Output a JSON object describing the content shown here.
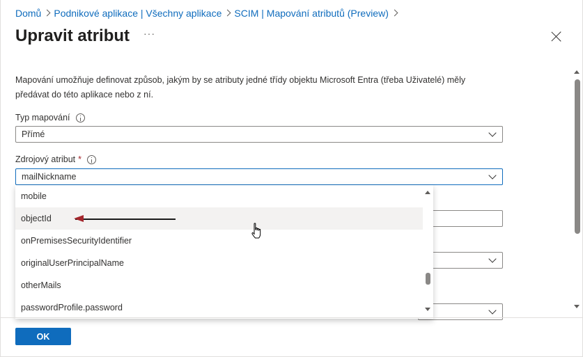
{
  "breadcrumb": [
    {
      "label": "Domů"
    },
    {
      "label": "Podnikové aplikace | Všechny aplikace"
    },
    {
      "label": "SCIM | Mapování atributů (Preview)"
    }
  ],
  "header": {
    "title": "Upravit atribut",
    "more_label": "···"
  },
  "description": "Mapování umožňuje definovat způsob, jakým by se atributy jedné třídy objektu Microsoft Entra (třeba Uživatelé) měly předávat do této aplikace nebo z ní.",
  "mapping_type": {
    "label": "Typ mapování",
    "value": "Přímé"
  },
  "source_attribute": {
    "label": "Zdrojový atribut",
    "required_mark": "*",
    "value": "mailNickname",
    "options": [
      "mobile",
      "objectId",
      "onPremisesSecurityIdentifier",
      "originalUserPrincipalName",
      "otherMails",
      "passwordProfile.password"
    ],
    "hovered_option": "objectId"
  },
  "footer": {
    "ok_label": "OK"
  },
  "colors": {
    "link": "#0f6cbd",
    "primary_button": "#0f6cbd",
    "arrow_head": "#a4262c"
  }
}
